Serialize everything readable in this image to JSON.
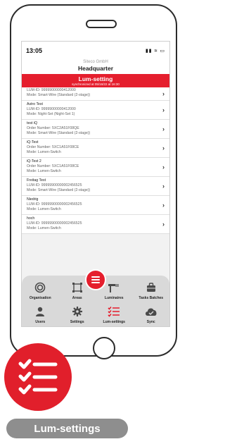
{
  "status_bar": {
    "time": "13:05",
    "icons": "signal-wifi-battery",
    "icon_text": "▮▮ ≈ ▭"
  },
  "header": {
    "company": "Siteco GmbH",
    "location": "Headquarter"
  },
  "banner": {
    "title": "Lum-setting",
    "subtitle": "synchronized at 05/16/22 at 16:30"
  },
  "luminaires": [
    {
      "lines": [
        "LUM-ID: 99999000000412000",
        "Mode: Smart-Wire (Standard (2-stage))"
      ]
    },
    {
      "lines": [
        "Astro Test",
        "LUM-ID: 99999000000412000",
        "Mode: Night-Set (Night-Set 1)"
      ]
    },
    {
      "lines": [
        "test iQ",
        "Order Number: 5XC2A51F08QE",
        "Mode: Smart-Wire (Standard (2-stage))"
      ]
    },
    {
      "lines": [
        "iQ-Test",
        "Order Number: 5XC1A51F08CE",
        "Mode: Lumen-Switch"
      ]
    },
    {
      "lines": [
        "iQ-Test 2",
        "Order Number: 5XC1A51F08CE",
        "Mode: Lumen-Switch"
      ]
    },
    {
      "lines": [
        "Freitag Test",
        "LUM-ID: 99999900000002456525",
        "Mode: Smart-Wire (Standard (2-stage))"
      ]
    },
    {
      "lines": [
        "Niedrig",
        "LUM-ID: 99999900000002456525",
        "Mode: Lumen-Switch"
      ]
    },
    {
      "lines": [
        "hoch",
        "LUM-ID: 99999900000002456525",
        "Mode: Lumen-Switch"
      ]
    }
  ],
  "chevron": "›",
  "nav": {
    "organisation": "Organisation",
    "areas": "Areas",
    "luminaires": "Luminaires",
    "tasks_batches": "Tasks Batches",
    "users": "Users",
    "settings": "Settings",
    "lum_settings": "Lum-settings",
    "sync": "Sync"
  },
  "caption": "Lum-settings",
  "colors": {
    "accent": "#e51e2d",
    "nav_bg": "#d9d9d9",
    "caption_bg": "#8e8e8e",
    "icon": "#4a4a4a"
  }
}
